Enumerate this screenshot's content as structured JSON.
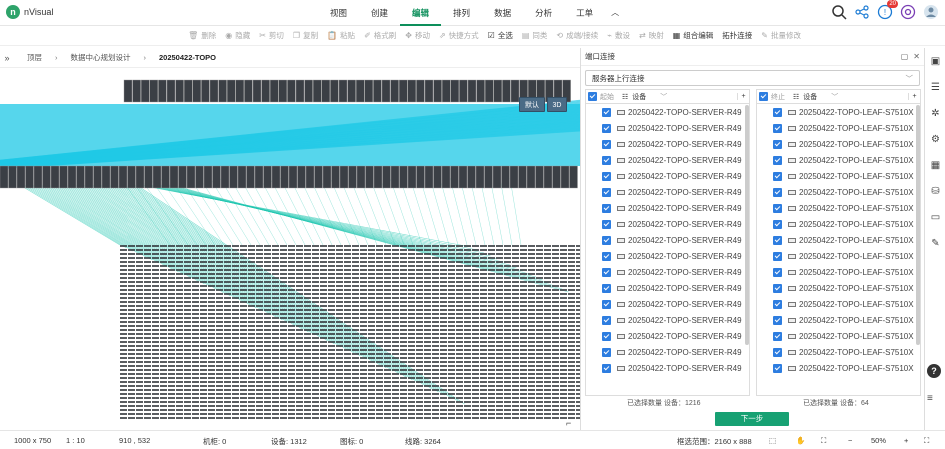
{
  "app": {
    "logo_letter": "n",
    "name": "nVisual"
  },
  "menu": {
    "items": [
      "视图",
      "创建",
      "编辑",
      "排列",
      "数据",
      "分析",
      "工单"
    ],
    "active_index": 2,
    "collapse_icon": "chevron-up-icon"
  },
  "top_icons": [
    "search-icon",
    "share-icon",
    "notification-icon",
    "settings-icon",
    "user-icon"
  ],
  "notification_badge": "20",
  "toolbar": {
    "tools": [
      {
        "label": "删除",
        "enabled": false,
        "icon": "trash-icon"
      },
      {
        "label": "隐藏",
        "enabled": false,
        "icon": "eye-icon"
      },
      {
        "label": "剪切",
        "enabled": false,
        "icon": "cut-icon"
      },
      {
        "label": "复制",
        "enabled": false,
        "icon": "copy-icon"
      },
      {
        "label": "粘贴",
        "enabled": false,
        "icon": "paste-icon"
      },
      {
        "label": "格式刷",
        "enabled": false,
        "icon": "brush-icon"
      },
      {
        "label": "移动",
        "enabled": false,
        "icon": "move-icon"
      },
      {
        "label": "快捷方式",
        "enabled": false,
        "icon": "link-icon"
      },
      {
        "label": "全选",
        "enabled": true,
        "icon": "check-square-icon"
      },
      {
        "label": "同类",
        "enabled": false,
        "icon": "similar-icon"
      },
      {
        "label": "成端/接续",
        "enabled": false,
        "icon": "connect-icon"
      },
      {
        "label": "敷设",
        "enabled": false,
        "icon": "lay-icon"
      },
      {
        "label": "映射",
        "enabled": false,
        "icon": "map-icon"
      },
      {
        "label": "组合编辑",
        "enabled": true,
        "icon": "group-edit-icon"
      },
      {
        "label": "拓扑连接",
        "enabled": true,
        "icon": ""
      },
      {
        "label": "批量修改",
        "enabled": false,
        "icon": "batch-edit-icon"
      }
    ]
  },
  "breadcrumb": [
    "顶层",
    "数据中心规划设计",
    "20250422-TOPO"
  ],
  "canvas": {
    "btn_default": "默认",
    "btn_3d": "3D",
    "line_color": "#1ec8e6",
    "line_color2": "#20c6b0"
  },
  "panel": {
    "title": "端口连接",
    "connection_type": "服务器上行连接",
    "left_column": {
      "label": "起始",
      "field": "设备"
    },
    "right_column": {
      "label": "终止",
      "field": "设备"
    },
    "left_rows": [
      "20250422-TOPO-SERVER-R49",
      "20250422-TOPO-SERVER-R49",
      "20250422-TOPO-SERVER-R49",
      "20250422-TOPO-SERVER-R49",
      "20250422-TOPO-SERVER-R49",
      "20250422-TOPO-SERVER-R49",
      "20250422-TOPO-SERVER-R49",
      "20250422-TOPO-SERVER-R49",
      "20250422-TOPO-SERVER-R49",
      "20250422-TOPO-SERVER-R49",
      "20250422-TOPO-SERVER-R49",
      "20250422-TOPO-SERVER-R49",
      "20250422-TOPO-SERVER-R49",
      "20250422-TOPO-SERVER-R49",
      "20250422-TOPO-SERVER-R49",
      "20250422-TOPO-SERVER-R49",
      "20250422-TOPO-SERVER-R49"
    ],
    "right_rows": [
      "20250422-TOPO-LEAF-S7510X",
      "20250422-TOPO-LEAF-S7510X",
      "20250422-TOPO-LEAF-S7510X",
      "20250422-TOPO-LEAF-S7510X",
      "20250422-TOPO-LEAF-S7510X",
      "20250422-TOPO-LEAF-S7510X",
      "20250422-TOPO-LEAF-S7510X",
      "20250422-TOPO-LEAF-S7510X",
      "20250422-TOPO-LEAF-S7510X",
      "20250422-TOPO-LEAF-S7510X",
      "20250422-TOPO-LEAF-S7510X",
      "20250422-TOPO-LEAF-S7510X",
      "20250422-TOPO-LEAF-S7510X",
      "20250422-TOPO-LEAF-S7510X",
      "20250422-TOPO-LEAF-S7510X",
      "20250422-TOPO-LEAF-S7510X",
      "20250422-TOPO-LEAF-S7510X"
    ],
    "left_count": "已选择数量 设备：1216",
    "right_count": "已选择数量 设备：64",
    "next_button": "下一步"
  },
  "status": {
    "size": "1000 x 750",
    "scale": "1 : 10",
    "coords": "910 , 532",
    "cabinets": "机柜: 0",
    "devices": "设备: 1312",
    "icons": "图标: 0",
    "lines": "线路: 3264",
    "range": "框选范围：2160 x 888",
    "zoom": "50%"
  },
  "right_sidebar_icons": [
    "panel-icon",
    "list-icon",
    "tree-icon",
    "gear-link-icon",
    "layout-icon",
    "bucket-icon",
    "monitor-icon",
    "tool-icon"
  ]
}
